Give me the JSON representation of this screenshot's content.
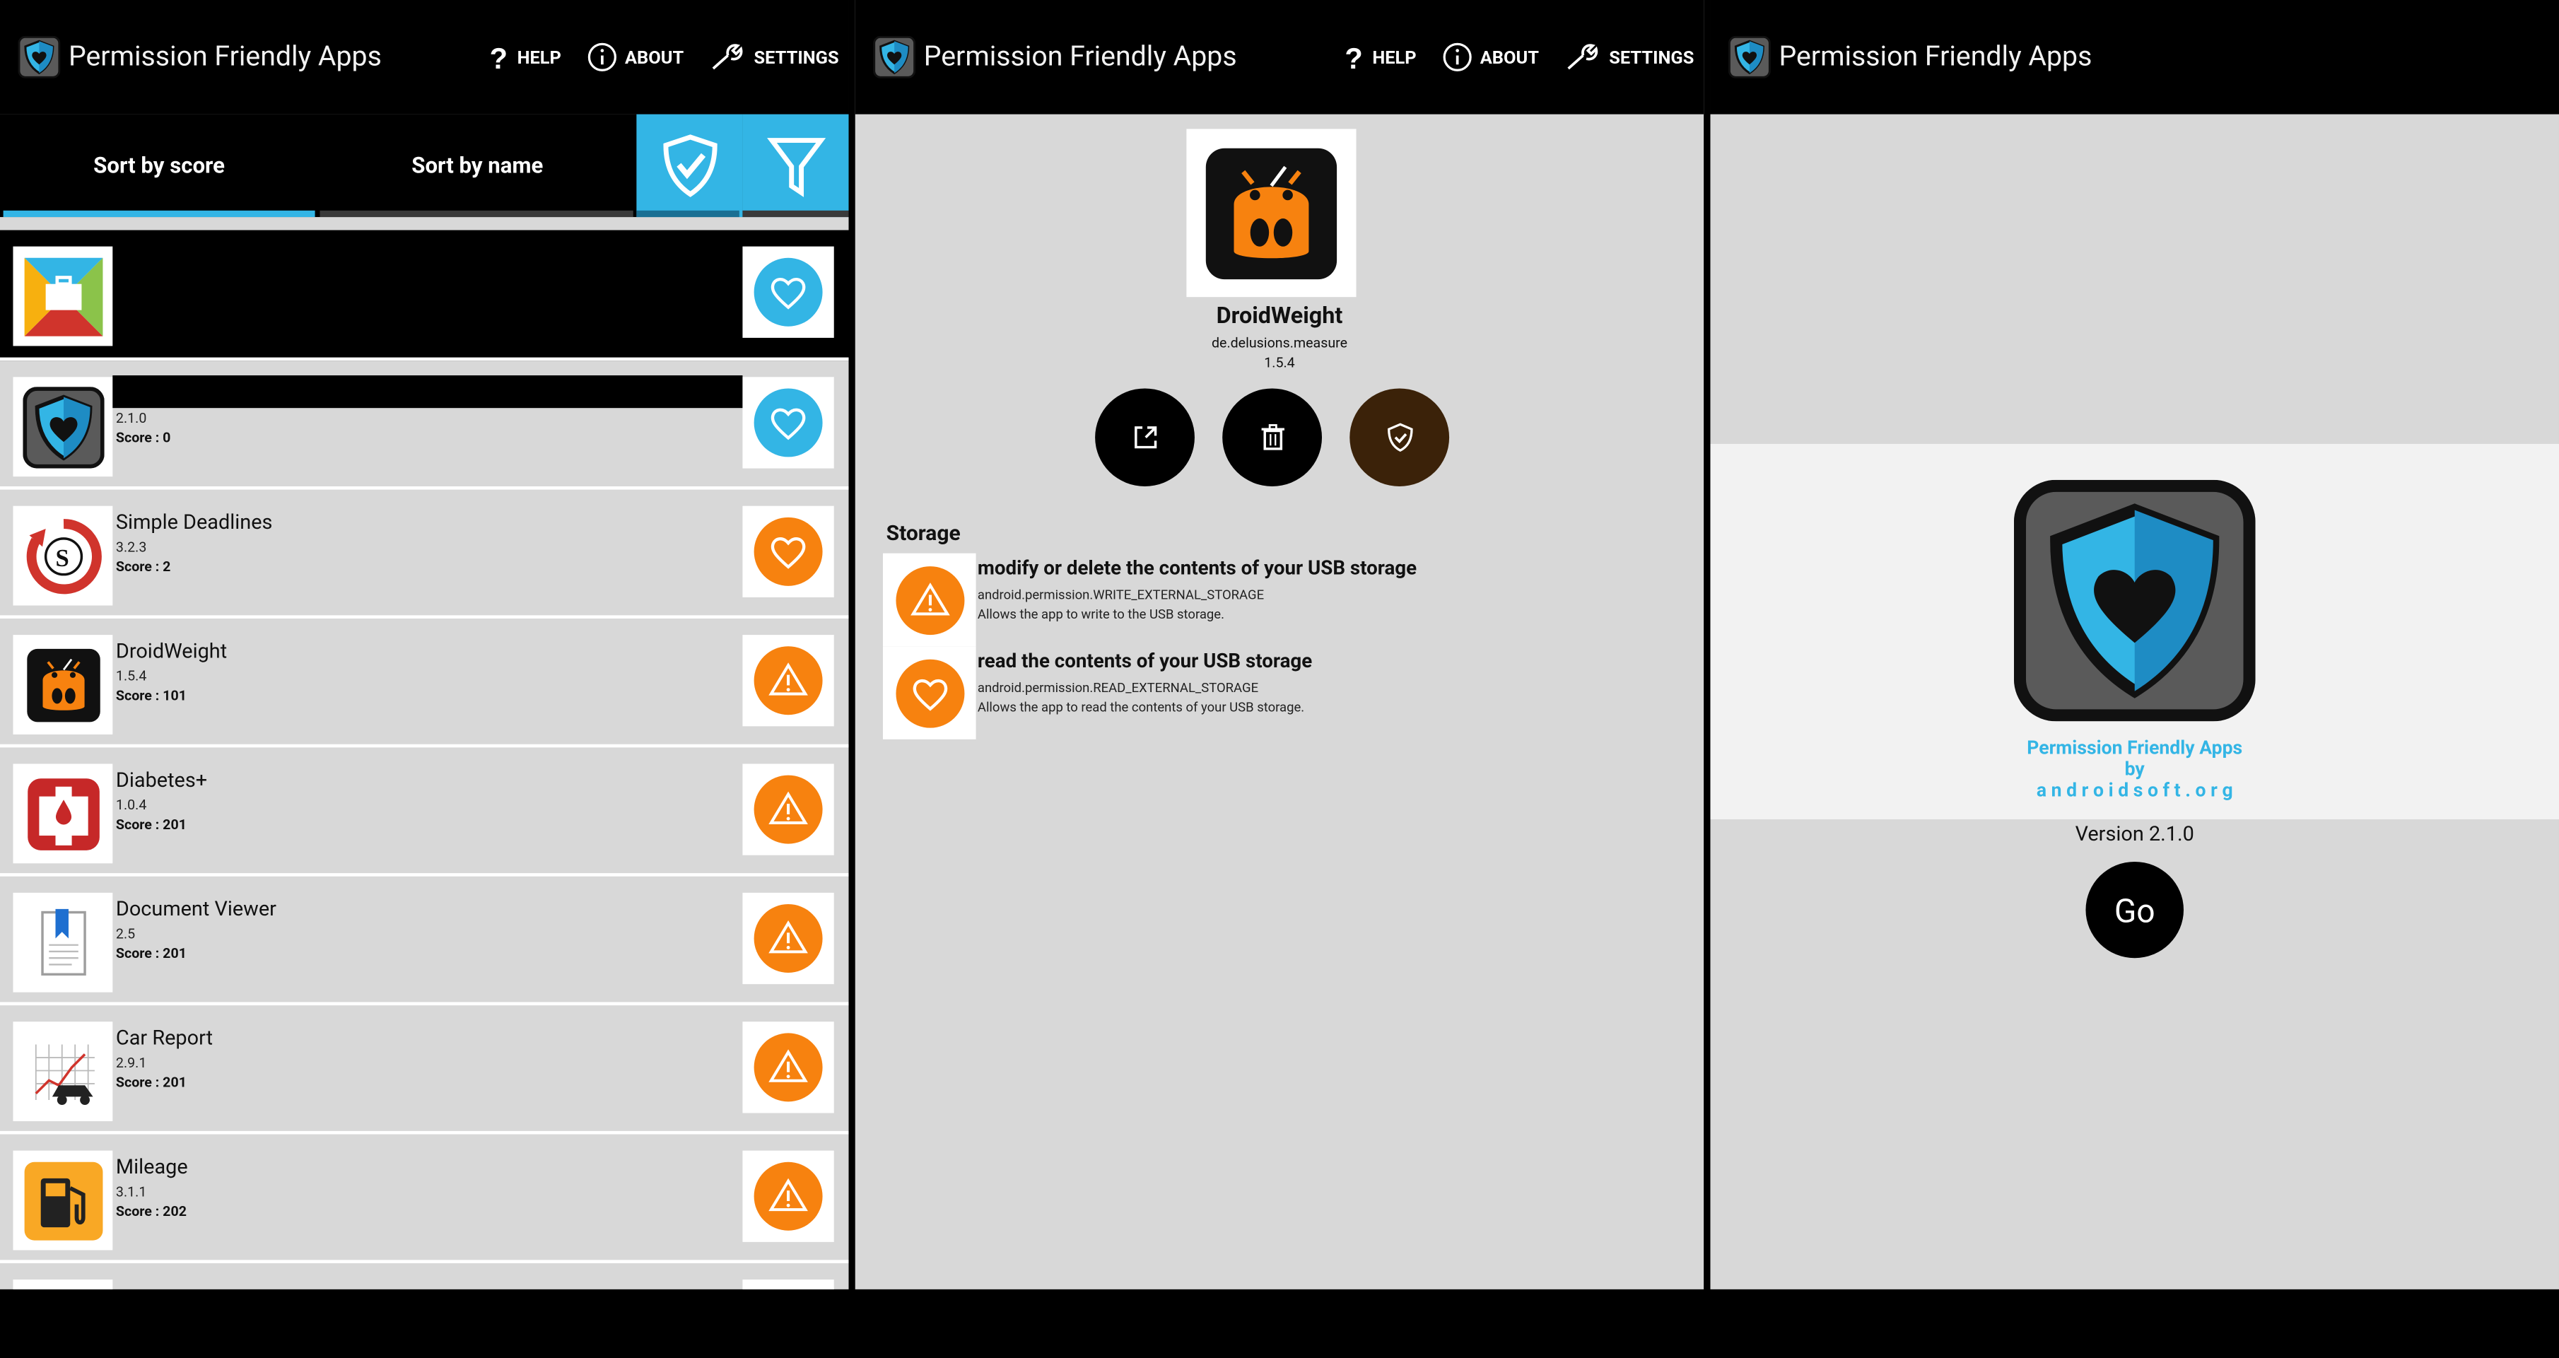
{
  "app_title": "Permission Friendly Apps",
  "actions": {
    "help": "HELP",
    "about": "ABOUT",
    "settings": "SETTINGS"
  },
  "tabs": {
    "score": "Sort by score",
    "name": "Sort by name"
  },
  "list": [
    {
      "name": "",
      "version": "",
      "score": "",
      "badge": "heart",
      "icon": "briefcase-app-icon"
    },
    {
      "name": "",
      "version": "2.1.0",
      "score": "Score : 0",
      "badge": "heart",
      "icon": "shield-app-icon"
    },
    {
      "name": "Simple Deadlines",
      "version": "3.2.3",
      "score": "Score : 2",
      "badge": "heart",
      "icon": "deadline-app-icon"
    },
    {
      "name": "DroidWeight",
      "version": "1.5.4",
      "score": "Score : 101",
      "badge": "warning",
      "icon": "droidweight-app-icon"
    },
    {
      "name": "Diabetes+",
      "version": "1.0.4",
      "score": "Score : 201",
      "badge": "warning",
      "icon": "diabetes-app-icon"
    },
    {
      "name": "Document Viewer",
      "version": "2.5",
      "score": "Score : 201",
      "badge": "warning",
      "icon": "document-viewer-app-icon"
    },
    {
      "name": "Car Report",
      "version": "2.9.1",
      "score": "Score : 201",
      "badge": "warning",
      "icon": "car-report-app-icon"
    },
    {
      "name": "Mileage",
      "version": "3.1.1",
      "score": "Score : 202",
      "badge": "warning",
      "icon": "mileage-app-icon"
    }
  ],
  "detail": {
    "name": "DroidWeight",
    "package": "de.delusions.measure",
    "version": "1.5.4",
    "section": "Storage",
    "permissions": [
      {
        "title": "modify or delete the contents of your USB storage",
        "name": "android.permission.WRITE_EXTERNAL_STORAGE",
        "desc": "Allows the app to write to the USB storage.",
        "badge": "warning"
      },
      {
        "title": "read the contents of your USB storage",
        "name": "android.permission.READ_EXTERNAL_STORAGE",
        "desc": "Allows the app to read the contents of your USB storage.",
        "badge": "heart"
      }
    ]
  },
  "about": {
    "line1": "Permission Friendly Apps",
    "line2": "by",
    "line3": "a n d r o i d s o f t . o r g",
    "version": "Version 2.1.0",
    "go": "Go"
  },
  "colors": {
    "accent": "#33b5e5",
    "warning": "#f7820f",
    "list_bg": "#d8d8d8",
    "bar": "#000000"
  }
}
